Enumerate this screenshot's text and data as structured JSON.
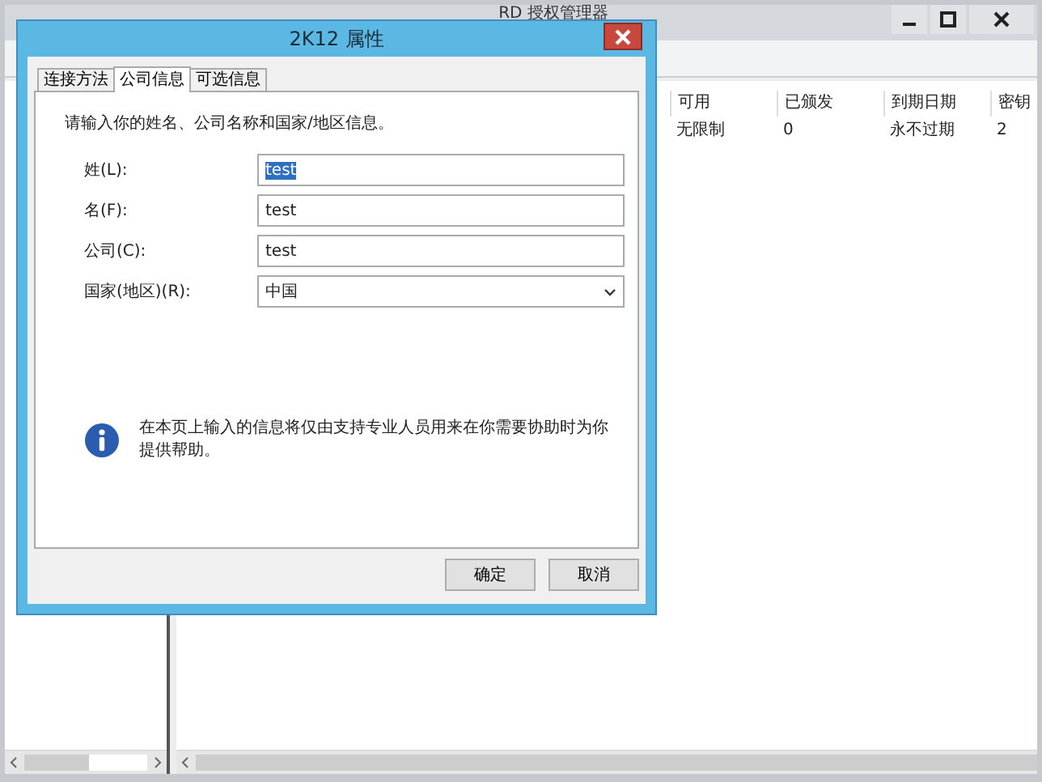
{
  "background_window": {
    "title": "RD 授权管理器",
    "columns": [
      "可用",
      "已颁发",
      "到期日期",
      "密钥"
    ],
    "rows": [
      [
        "无限制",
        "0",
        "永不过期",
        "2"
      ]
    ]
  },
  "dialog": {
    "title": "2K12 属性",
    "tabs": [
      {
        "label": "连接方法",
        "selected": false
      },
      {
        "label": "公司信息",
        "selected": true
      },
      {
        "label": "可选信息",
        "selected": false
      }
    ],
    "intro": "请输入你的姓名、公司名称和国家/地区信息。",
    "fields": [
      {
        "label": "姓(L):",
        "value": "test",
        "kind": "text",
        "highlighted": true
      },
      {
        "label": "名(F):",
        "value": "test",
        "kind": "text",
        "highlighted": false
      },
      {
        "label": "公司(C):",
        "value": "test",
        "kind": "text",
        "highlighted": false
      },
      {
        "label": "国家(地区)(R):",
        "value": "中国",
        "kind": "dropdown",
        "highlighted": false
      }
    ],
    "note": "在本页上输入的信息将仅由支持专业人员用来在你需要协助时为你提供帮助。",
    "buttons": [
      "确定",
      "取消"
    ]
  }
}
